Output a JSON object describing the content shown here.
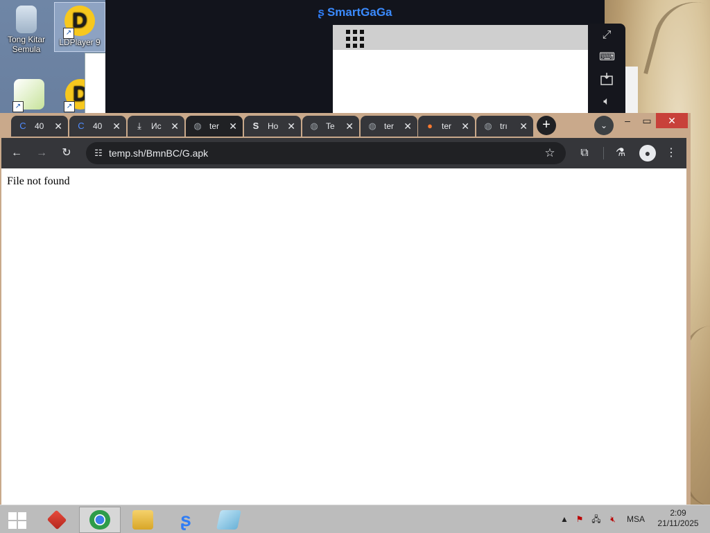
{
  "desktop": {
    "icons": [
      {
        "label": "Tong Kitar Semula"
      },
      {
        "label": "LDPlayer 9"
      }
    ]
  },
  "smartgaga": {
    "title": "SmartGaGa"
  },
  "chrome": {
    "tabs": [
      {
        "title": "40",
        "icon": "c-logo-icon"
      },
      {
        "title": "40",
        "icon": "c-logo-icon"
      },
      {
        "title": "Ис",
        "icon": "download-icon"
      },
      {
        "title": "ter",
        "icon": "globe-icon",
        "active": true
      },
      {
        "title": "Ho",
        "icon": "s-logo-icon"
      },
      {
        "title": "Te",
        "icon": "globe-icon"
      },
      {
        "title": "ter",
        "icon": "globe-icon"
      },
      {
        "title": "ter",
        "icon": "orange-circle-icon"
      },
      {
        "title": "trı",
        "icon": "globe-icon"
      }
    ],
    "address": {
      "url": "temp.sh/BmnBC/G.apk"
    },
    "page": {
      "text": "File not found"
    }
  },
  "taskbar": {
    "language": "MSA",
    "time": "2:09",
    "date": "21/11/2025"
  },
  "colors": {
    "chrome_frame": "#c9a98b",
    "toolbar": "#35363a",
    "close_button": "#c8413a",
    "smartgaga_brand": "#3b8bff"
  }
}
